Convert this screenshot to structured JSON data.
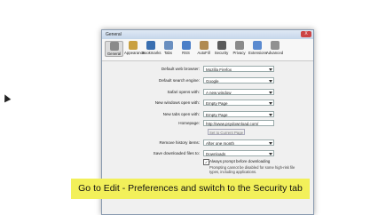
{
  "window": {
    "title": "General",
    "close": "X"
  },
  "toolbar": [
    {
      "label": "General",
      "color": "#8a8a8a",
      "selected": true
    },
    {
      "label": "Appearance",
      "color": "#c9a040"
    },
    {
      "label": "Bookmarks",
      "color": "#3a6fb0"
    },
    {
      "label": "Tabs",
      "color": "#6a8fc0"
    },
    {
      "label": "RSS",
      "color": "#4a7ec8"
    },
    {
      "label": "AutoFill",
      "color": "#b08a50"
    },
    {
      "label": "Security",
      "color": "#5a5a5a"
    },
    {
      "label": "Privacy",
      "color": "#8a8a8a"
    },
    {
      "label": "Extensions",
      "color": "#5a8ad0"
    },
    {
      "label": "Advanced",
      "color": "#909090"
    }
  ],
  "settings": {
    "default_browser": {
      "label": "Default web browser:",
      "value": "Mozilla Firefox"
    },
    "default_search": {
      "label": "Default search engine:",
      "value": "Google"
    },
    "safari_opens": {
      "label": "Safari opens with:",
      "value": "A new window"
    },
    "new_windows": {
      "label": "New windows open with:",
      "value": "Empty Page"
    },
    "new_tabs": {
      "label": "New tabs open with:",
      "value": "Empty Page"
    },
    "homepage": {
      "label": "Homepage:",
      "value": "http://www.psydownload.com/"
    },
    "set_current_page": "Set to Current Page",
    "remove_history": {
      "label": "Remove history items:",
      "value": "After one month"
    },
    "save_downloads": {
      "label": "Save downloaded files to:",
      "value": "Downloads"
    },
    "always_prompt": {
      "label": "Always prompt before downloading",
      "checked": "✓"
    },
    "prompt_note": "Prompting cannot be disabled for some high-risk file types, including applications.",
    "remove_download": {
      "label": "Remove download list items:",
      "value": "Manually"
    }
  },
  "caption": "Go to Edit - Preferences and switch to the Security tab"
}
